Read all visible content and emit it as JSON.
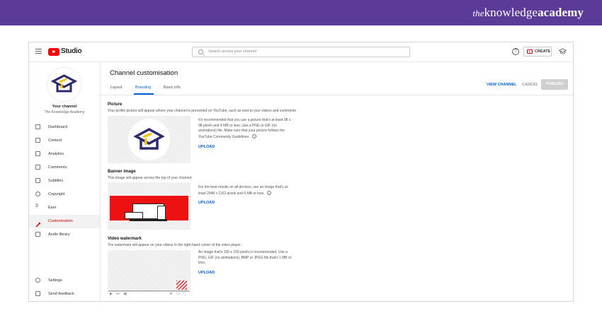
{
  "brand": {
    "prefix": "the",
    "main": "knowledge",
    "bold": "academy"
  },
  "topbar": {
    "app_name": "Studio",
    "search_placeholder": "Search across your channel",
    "help_glyph": "?",
    "create_label": "CREATE"
  },
  "sidebar": {
    "channel_title": "Your channel",
    "channel_name": "The Knowledge Academy",
    "items": [
      {
        "label": "Dashboard",
        "icon": "dashboard-icon"
      },
      {
        "label": "Content",
        "icon": "content-icon"
      },
      {
        "label": "Analytics",
        "icon": "analytics-icon"
      },
      {
        "label": "Comments",
        "icon": "comments-icon"
      },
      {
        "label": "Subtitles",
        "icon": "subtitles-icon"
      },
      {
        "label": "Copyright",
        "icon": "copyright-icon"
      },
      {
        "label": "Earn",
        "icon": "earn-icon"
      },
      {
        "label": "Customisation",
        "icon": "customisation-icon",
        "active": true
      },
      {
        "label": "Audio library",
        "icon": "audio-library-icon"
      }
    ],
    "bottom": [
      {
        "label": "Settings",
        "icon": "settings-icon"
      },
      {
        "label": "Send feedback",
        "icon": "feedback-icon"
      }
    ]
  },
  "main": {
    "title": "Channel customisation",
    "tabs": [
      {
        "label": "Layout"
      },
      {
        "label": "Branding",
        "active": true
      },
      {
        "label": "Basic info"
      }
    ],
    "view_channel": "VIEW CHANNEL",
    "cancel": "CANCEL",
    "publish": "PUBLISH",
    "sections": {
      "picture": {
        "title": "Picture",
        "desc": "Your profile picture will appear where your channel is presented on YouTube, such as next to your videos and comments",
        "info": "It's recommended that you use a picture that's at least 98 x 98 pixels and 4 MB or less. Use a PNG or GIF (no animations) file. Make sure that your picture follows the YouTube Community Guidelines.",
        "upload": "UPLOAD"
      },
      "banner": {
        "title": "Banner image",
        "desc": "This image will appear across the top of your channel.",
        "info": "For the best results on all devices, use an image that's at least 2048 x 1152 pixels and 6 MB or less.",
        "upload": "UPLOAD"
      },
      "watermark": {
        "title": "Video watermark",
        "desc": "The watermark will appear on your videos in the right-hand corner of the video player.",
        "info": "An image that's 150 x 150 pixels is recommended. Use a PNG, GIF (no animations), BMP or JPEG file that's 1 MB or less.",
        "upload": "UPLOAD"
      }
    }
  },
  "colors": {
    "brand_bar": "#5b3a98",
    "accent": "#065fd4",
    "youtube_red": "#ff0000",
    "logo_navy": "#2d2a6e",
    "logo_yellow": "#f2c318"
  }
}
